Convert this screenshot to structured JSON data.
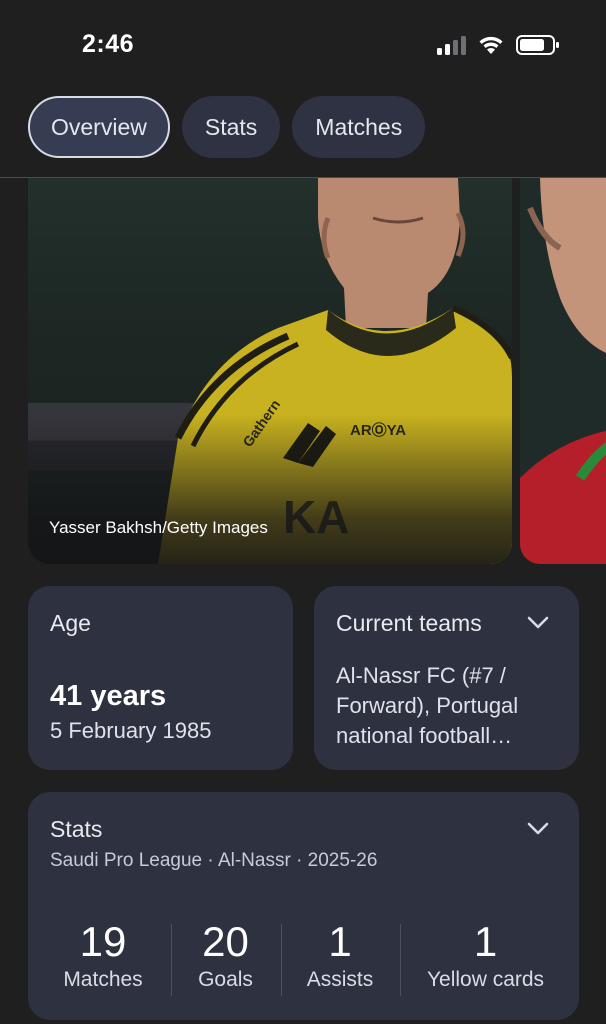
{
  "status_bar": {
    "time": "2:46"
  },
  "tabs": [
    {
      "label": "Overview",
      "active": true
    },
    {
      "label": "Stats",
      "active": false
    },
    {
      "label": "Matches",
      "active": false
    }
  ],
  "photo": {
    "credit": "Yasser Bakhsh/Getty Images"
  },
  "age": {
    "label": "Age",
    "years": "41 years",
    "birth_date": "5 February 1985"
  },
  "current_teams": {
    "label": "Current teams",
    "text": "Al-Nassr FC (#7 / Forward), Portugal national football…"
  },
  "stats": {
    "label": "Stats",
    "subtitle": "Saudi Pro League · Al-Nassr · 2025-26",
    "items": [
      {
        "value": "19",
        "label": "Matches"
      },
      {
        "value": "20",
        "label": "Goals"
      },
      {
        "value": "1",
        "label": "Assists"
      },
      {
        "value": "1",
        "label": "Yellow cards"
      }
    ]
  },
  "colors": {
    "background": "#1f1f20",
    "card": "#2d3140",
    "tab": "#2e3242",
    "active_tab_border": "#d7dbe6"
  }
}
